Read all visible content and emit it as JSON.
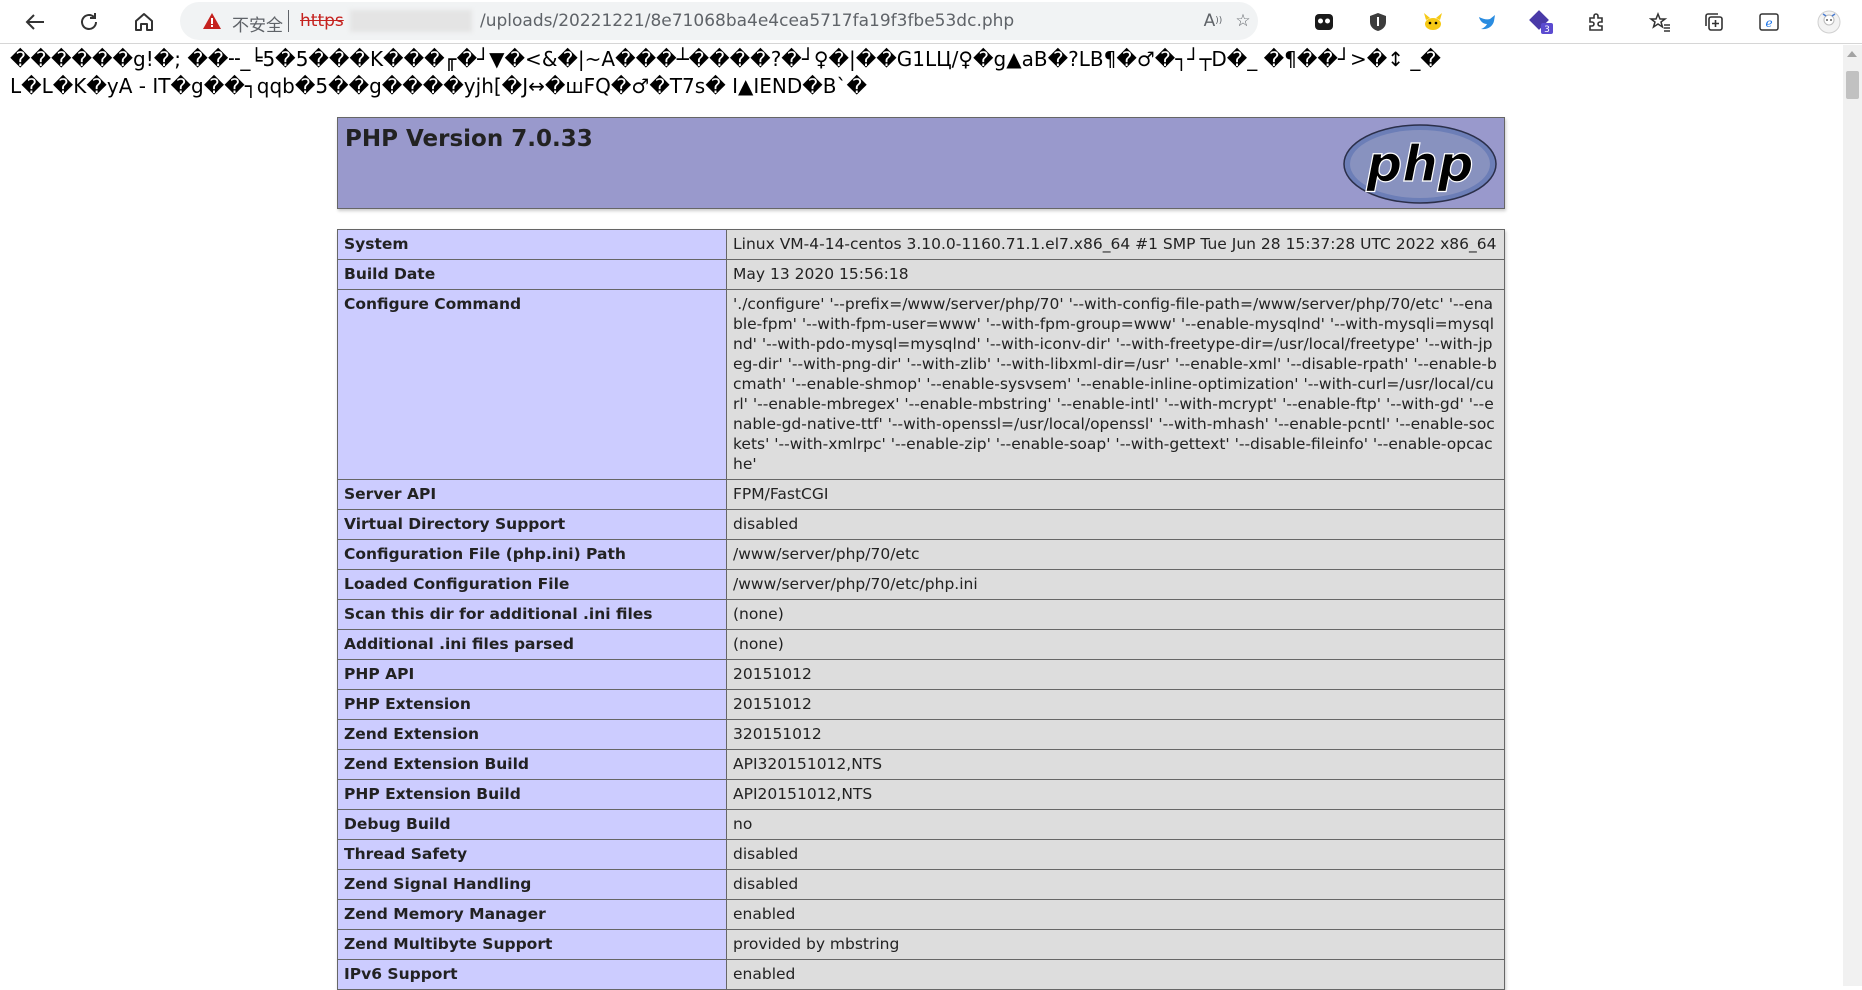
{
  "browser": {
    "security_warning": "不安全",
    "url_scheme": "https",
    "url_rest": "/uploads/20221221/8e71068ba4e4cea5717fa19f3fbe53dc.php",
    "extension_badge": "3"
  },
  "garbled_output": "������g!�; ��╌_╘5�5���K���╓�┘▼�<&�|~A���┴����?�┘♀�|��G1LЦ/♀�g▲aB�?LB¶�♂�┐┘┬D�_ �¶��┘>�↕ _�L�L�K�yA - IT�g��┐qqb�5��g����yjh[�J↔�шFQ�♂�T7s� I▲IEND�B`�",
  "php": {
    "version_title": "PHP Version 7.0.33",
    "logo_text": "php",
    "rows": [
      {
        "label": "System",
        "value": "Linux VM-4-14-centos 3.10.0-1160.71.1.el7.x86_64 #1 SMP Tue Jun 28 15:37:28 UTC 2022 x86_64"
      },
      {
        "label": "Build Date",
        "value": "May 13 2020 15:56:18"
      },
      {
        "label": "Configure Command",
        "value": "'./configure' '--prefix=/www/server/php/70' '--with-config-file-path=/www/server/php/70/etc' '--enable-fpm' '--with-fpm-user=www' '--with-fpm-group=www' '--enable-mysqlnd' '--with-mysqli=mysqlnd' '--with-pdo-mysql=mysqlnd' '--with-iconv-dir' '--with-freetype-dir=/usr/local/freetype' '--with-jpeg-dir' '--with-png-dir' '--with-zlib' '--with-libxml-dir=/usr' '--enable-xml' '--disable-rpath' '--enable-bcmath' '--enable-shmop' '--enable-sysvsem' '--enable-inline-optimization' '--with-curl=/usr/local/curl' '--enable-mbregex' '--enable-mbstring' '--enable-intl' '--with-mcrypt' '--enable-ftp' '--with-gd' '--enable-gd-native-ttf' '--with-openssl=/usr/local/openssl' '--with-mhash' '--enable-pcntl' '--enable-sockets' '--with-xmlrpc' '--enable-zip' '--enable-soap' '--with-gettext' '--disable-fileinfo' '--enable-opcache'"
      },
      {
        "label": "Server API",
        "value": "FPM/FastCGI"
      },
      {
        "label": "Virtual Directory Support",
        "value": "disabled"
      },
      {
        "label": "Configuration File (php.ini) Path",
        "value": "/www/server/php/70/etc"
      },
      {
        "label": "Loaded Configuration File",
        "value": "/www/server/php/70/etc/php.ini"
      },
      {
        "label": "Scan this dir for additional .ini files",
        "value": "(none)"
      },
      {
        "label": "Additional .ini files parsed",
        "value": "(none)"
      },
      {
        "label": "PHP API",
        "value": "20151012"
      },
      {
        "label": "PHP Extension",
        "value": "20151012"
      },
      {
        "label": "Zend Extension",
        "value": "320151012"
      },
      {
        "label": "Zend Extension Build",
        "value": "API320151012,NTS"
      },
      {
        "label": "PHP Extension Build",
        "value": "API20151012,NTS"
      },
      {
        "label": "Debug Build",
        "value": "no"
      },
      {
        "label": "Thread Safety",
        "value": "disabled"
      },
      {
        "label": "Zend Signal Handling",
        "value": "disabled"
      },
      {
        "label": "Zend Memory Manager",
        "value": "enabled"
      },
      {
        "label": "Zend Multibyte Support",
        "value": "provided by mbstring"
      },
      {
        "label": "IPv6 Support",
        "value": "enabled"
      }
    ]
  },
  "colors": {
    "header_bg": "#9999cc",
    "label_cell_bg": "#ccccff",
    "value_cell_bg": "#dddddd",
    "insecure_red": "#c5221f"
  }
}
